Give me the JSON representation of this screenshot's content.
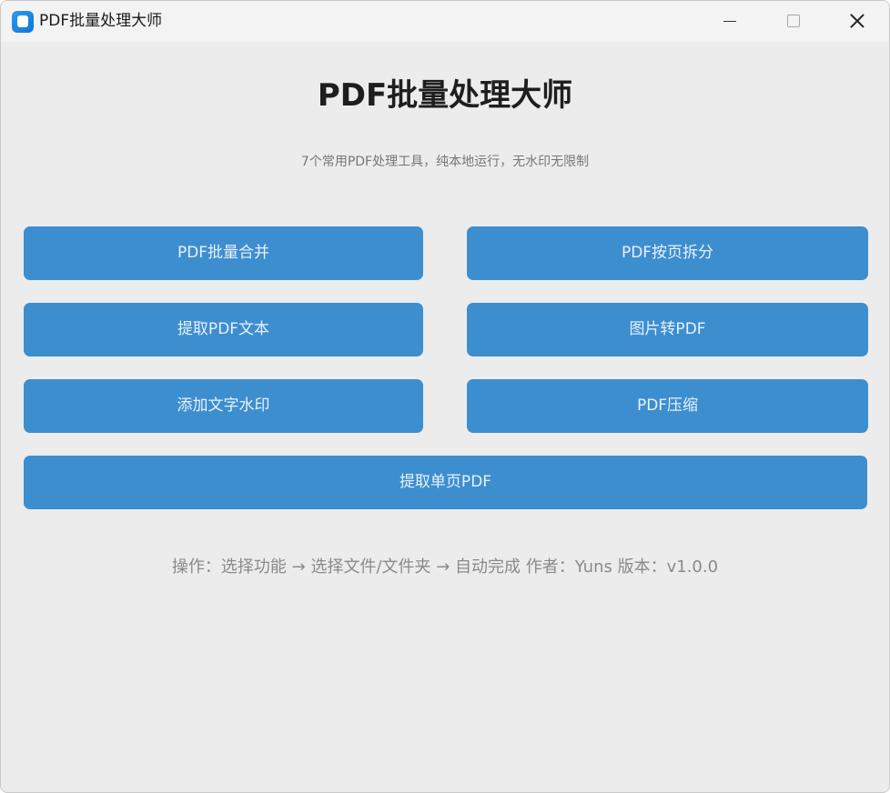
{
  "window": {
    "title": "PDF批量处理大师",
    "icon": "app-icon",
    "controls": [
      "minimize-icon",
      "maximize-icon",
      "close-icon"
    ]
  },
  "header": {
    "title": "PDF批量处理大师",
    "subtitle": "7个常用PDF处理工具，纯本地运行，无水印无限制"
  },
  "tools": {
    "merge": "PDF批量合并",
    "split": "PDF按页拆分",
    "extract_text": "提取PDF文本",
    "image_to_pdf": "图片转PDF",
    "watermark": "添加文字水印",
    "compress": "PDF压缩",
    "extract_page": "提取单页PDF"
  },
  "footer": {
    "text": "操作：选择功能 → 选择文件/文件夹 → 自动完成  作者：Yuns 版本：v1.0.0"
  },
  "colors": {
    "button_bg": "#3d8ecf",
    "button_text": "#e8f1fa",
    "window_bg": "#ececec",
    "titlebar_bg": "#f3f3f3"
  }
}
